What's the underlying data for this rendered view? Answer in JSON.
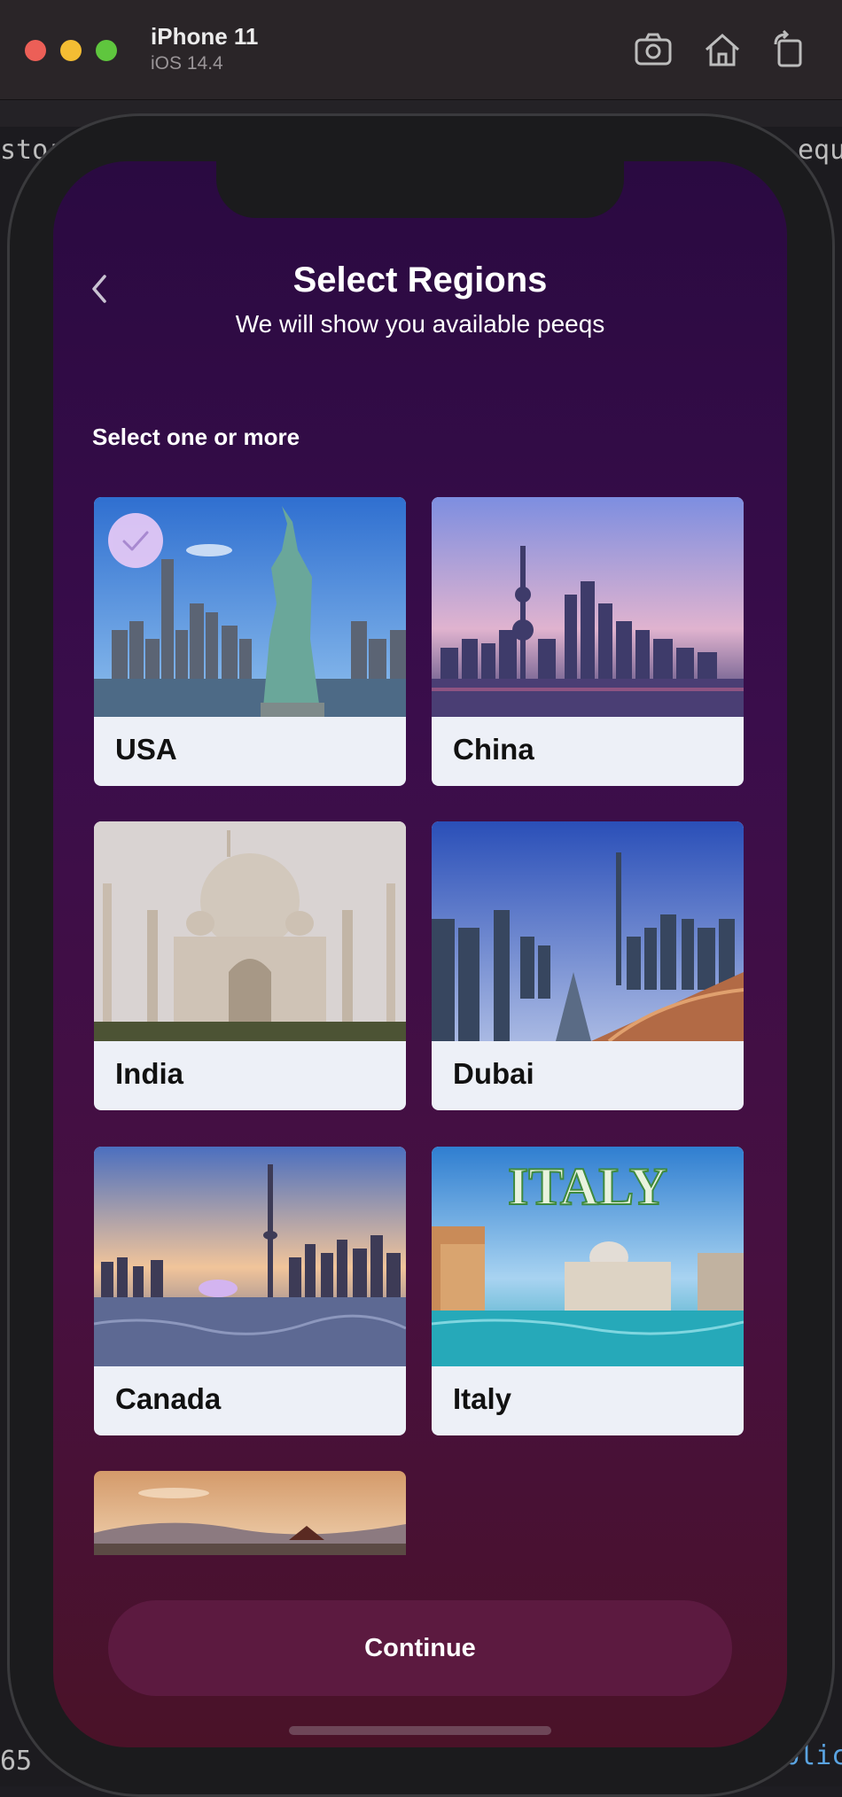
{
  "simulator": {
    "device_name": "iPhone 11",
    "os_version": "iOS 14.4",
    "toolbar": [
      "screenshot-icon",
      "home-icon",
      "rotate-icon"
    ]
  },
  "editor": {
    "fragments": [
      "stor",
      "equ",
      "65",
      "blic"
    ]
  },
  "header": {
    "title": "Select Regions",
    "subtitle": "We will show you available peeqs",
    "back_icon": "chevron-left-icon"
  },
  "section_label": "Select one or more",
  "regions": [
    {
      "label": "USA",
      "selected": true
    },
    {
      "label": "China",
      "selected": false
    },
    {
      "label": "India",
      "selected": false
    },
    {
      "label": "Dubai",
      "selected": false
    },
    {
      "label": "Canada",
      "selected": false
    },
    {
      "label": "Italy",
      "selected": false,
      "image_text": "ITALY"
    }
  ],
  "continue_label": "Continue",
  "colors": {
    "screen_top": "#2a0a41",
    "screen_bottom": "#4a1228",
    "card_bg": "#edf0f7",
    "button_bg": "#5c1a40",
    "check_badge": "#e7c9f6"
  }
}
